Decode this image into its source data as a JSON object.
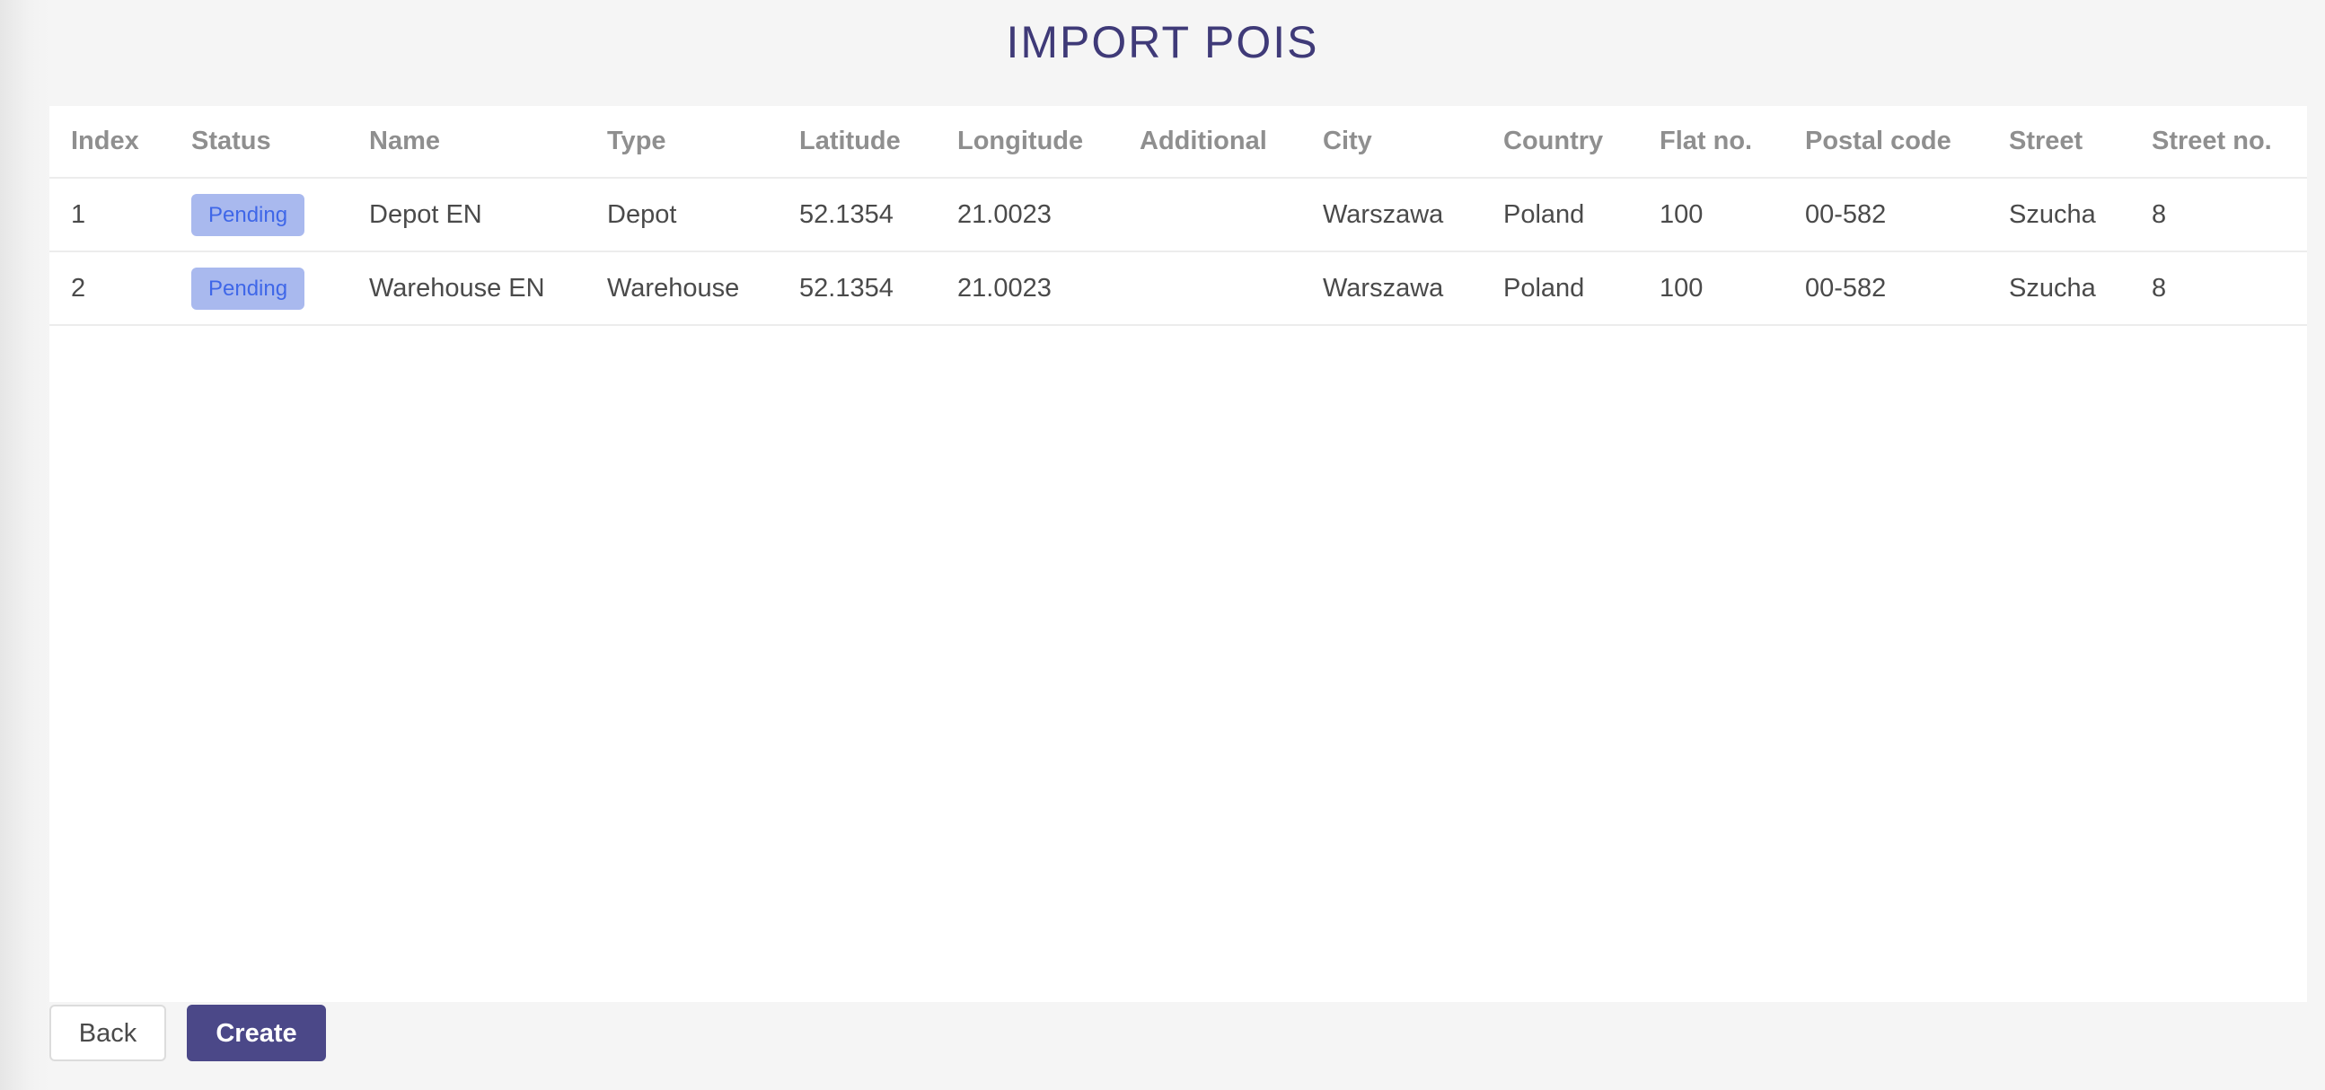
{
  "page": {
    "title": "IMPORT POIS"
  },
  "table": {
    "columns": [
      "Index",
      "Status",
      "Name",
      "Type",
      "Latitude",
      "Longitude",
      "Additional",
      "City",
      "Country",
      "Flat no.",
      "Postal code",
      "Street",
      "Street no."
    ],
    "rows": [
      {
        "index": "1",
        "status": "Pending",
        "name": "Depot EN",
        "type": "Depot",
        "latitude": "52.1354",
        "longitude": "21.0023",
        "additional": "",
        "city": "Warszawa",
        "country": "Poland",
        "flat_no": "100",
        "postal_code": "00-582",
        "street": "Szucha",
        "street_no": "8"
      },
      {
        "index": "2",
        "status": "Pending",
        "name": "Warehouse EN",
        "type": "Warehouse",
        "latitude": "52.1354",
        "longitude": "21.0023",
        "additional": "",
        "city": "Warszawa",
        "country": "Poland",
        "flat_no": "100",
        "postal_code": "00-582",
        "street": "Szucha",
        "street_no": "8"
      }
    ]
  },
  "actions": {
    "back_label": "Back",
    "create_label": "Create"
  },
  "colors": {
    "title": "#3f3a78",
    "pending_badge_bg": "#a9b9ee",
    "pending_badge_text": "#3f67e8",
    "primary_button": "#4b4888"
  }
}
